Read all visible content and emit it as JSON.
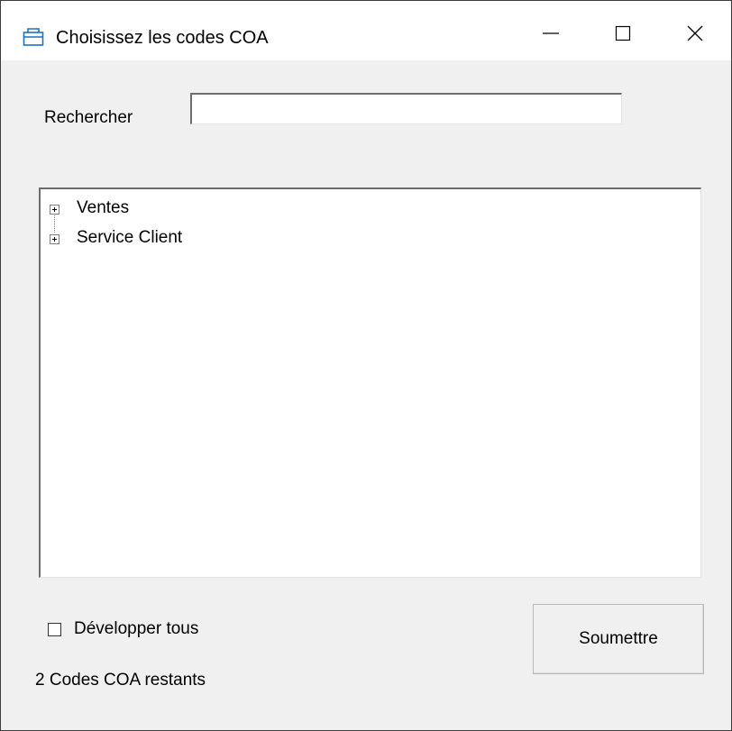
{
  "window": {
    "title": "Choisissez les codes COA",
    "controls": {
      "minimize": "—",
      "maximize": "☐",
      "close": "✕"
    },
    "icon": "window-app-icon",
    "accent": "#1a73c7"
  },
  "search": {
    "label": "Rechercher",
    "value": "",
    "placeholder": ""
  },
  "tree": {
    "items": [
      {
        "label": "Ventes",
        "expander": "+",
        "expanded": false
      },
      {
        "label": "Service Client",
        "expander": "+",
        "expanded": false
      }
    ]
  },
  "expand_all": {
    "label": "Développer tous",
    "checked": false
  },
  "submit": {
    "label": "Soumettre"
  },
  "status": {
    "text": "2 Codes COA restants"
  }
}
